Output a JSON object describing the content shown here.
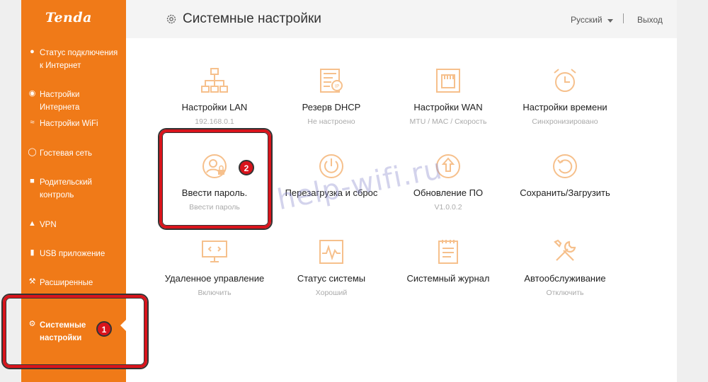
{
  "brand": {
    "logo": "Tenda",
    "accent": "#f07a18"
  },
  "header": {
    "title": "Системные настройки",
    "language": "Русский",
    "logout": "Выход"
  },
  "sidebar": {
    "items": [
      {
        "label": "Статус подключения к Интернет",
        "icon": "status-icon"
      },
      {
        "label": "Настройки Интернета",
        "icon": "globe-icon"
      },
      {
        "label": "Настройки WiFi",
        "icon": "wifi-icon"
      },
      {
        "label": "Гостевая сеть",
        "icon": "guest-icon"
      },
      {
        "label": "Родительский контроль",
        "icon": "parental-icon"
      },
      {
        "label": "VPN",
        "icon": "vpn-icon"
      },
      {
        "label": "USB приложение",
        "icon": "usb-icon"
      },
      {
        "label": "Расширенные",
        "icon": "wrench-icon"
      },
      {
        "label": "Системные настройки",
        "icon": "gear-icon",
        "active": true
      }
    ]
  },
  "tiles": [
    {
      "label": "Настройки LAN",
      "sub": "192.168.0.1",
      "icon": "lan-icon"
    },
    {
      "label": "Резерв DHCP",
      "sub": "Не настроено",
      "icon": "dhcp-icon"
    },
    {
      "label": "Настройки WAN",
      "sub": "MTU / MAC / Скорость",
      "icon": "wan-icon"
    },
    {
      "label": "Настройки времени",
      "sub": "Синхронизировано",
      "icon": "alarm-clock-icon"
    },
    {
      "label": "Ввести пароль.",
      "sub": "Ввести пароль",
      "icon": "user-lock-icon"
    },
    {
      "label": "Перезагрузка и сброс",
      "sub": "",
      "icon": "power-icon"
    },
    {
      "label": "Обновление ПО",
      "sub": "V1.0.0.2",
      "icon": "upgrade-icon"
    },
    {
      "label": "Сохранить/Загрузить",
      "sub": "",
      "icon": "backup-icon"
    },
    {
      "label": "Удаленное управление",
      "sub": "Включить",
      "icon": "remote-icon"
    },
    {
      "label": "Статус системы",
      "sub": "Хороший",
      "icon": "pulse-icon"
    },
    {
      "label": "Системный журнал",
      "sub": "",
      "icon": "log-icon"
    },
    {
      "label": "Автообслуживание",
      "sub": "Отключить",
      "icon": "tools-icon"
    }
  ],
  "annotations": {
    "badge1": "1",
    "badge2": "2",
    "watermark": "help-wifi.ru"
  }
}
